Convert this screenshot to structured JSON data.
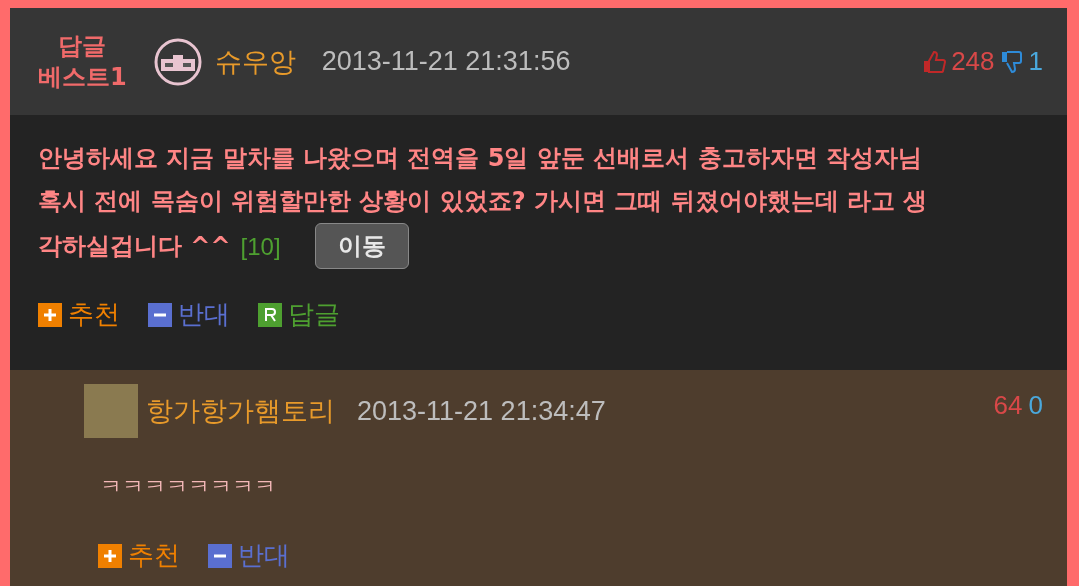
{
  "best_comment": {
    "badge_line1": "답글",
    "badge_line2": "베스트1",
    "author": "슈우앙",
    "timestamp": "2013-11-21 21:31:56",
    "likes": "248",
    "dislikes": "1",
    "body_lines": [
      "안녕하세요 지금 말차를 나왔으며 전역을 5일 앞둔 선배로서 충고하자면 작성자님",
      "혹시 전에 목숨이 위험할만한 상황이 있었죠? 가시면 그때 뒤졌어야했는데 라고 생",
      "각하실겁니다 ^^"
    ],
    "reply_count": "[10]",
    "move_button": "이동",
    "actions": [
      {
        "kind": "recommend",
        "label": "추천"
      },
      {
        "kind": "oppose",
        "label": "반대"
      },
      {
        "kind": "reply",
        "label": "답글"
      }
    ]
  },
  "reply": {
    "author": "항가항가햄토리",
    "timestamp": "2013-11-21 21:34:47",
    "likes": "64",
    "dislikes": "0",
    "body": "ㅋㅋㅋㅋㅋㅋㅋㅋ",
    "actions": [
      {
        "kind": "recommend",
        "label": "추천"
      },
      {
        "kind": "oppose",
        "label": "반대"
      }
    ]
  }
}
